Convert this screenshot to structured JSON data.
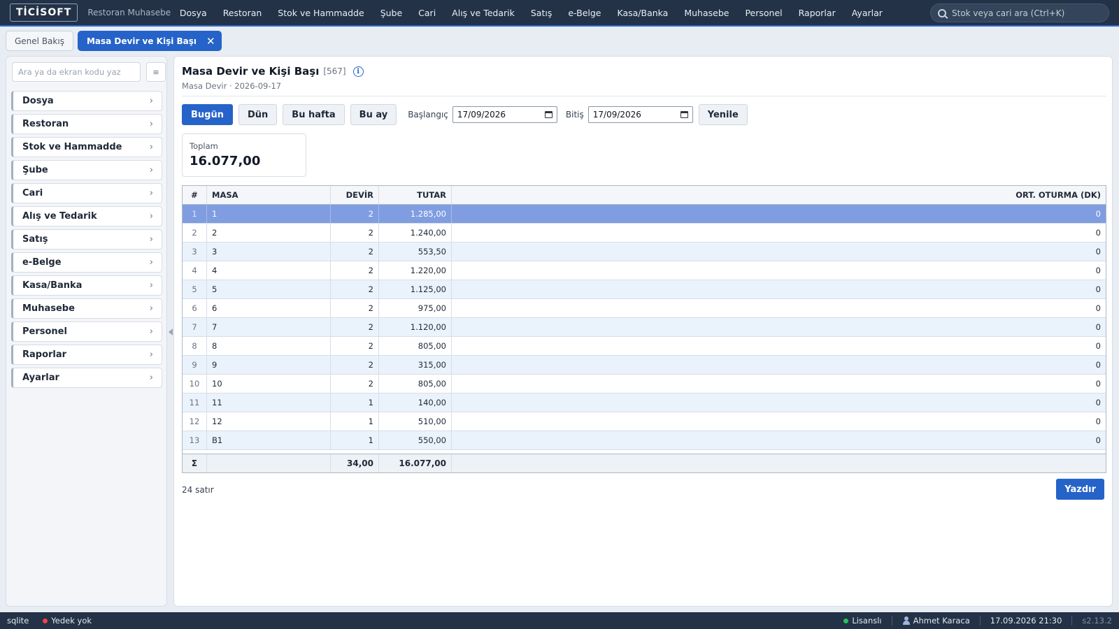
{
  "app": {
    "logo": "TİCİSOFT",
    "subtitle": "Restoran Muhasebe"
  },
  "topnav": [
    "Dosya",
    "Restoran",
    "Stok ve Hammadde",
    "Şube",
    "Cari",
    "Alış ve Tedarik",
    "Satış",
    "e-Belge",
    "Kasa/Banka",
    "Muhasebe",
    "Personel",
    "Raporlar",
    "Ayarlar"
  ],
  "search": {
    "placeholder": "Stok veya cari ara (Ctrl+K)"
  },
  "tabs": [
    {
      "label": "Genel Bakış",
      "active": false
    },
    {
      "label": "Masa Devir ve Kişi Başı",
      "active": true
    }
  ],
  "sidebar": {
    "search_placeholder": "Ara ya da ekran kodu yaz",
    "items": [
      "Dosya",
      "Restoran",
      "Stok ve Hammadde",
      "Şube",
      "Cari",
      "Alış ve Tedarik",
      "Satış",
      "e-Belge",
      "Kasa/Banka",
      "Muhasebe",
      "Personel",
      "Raporlar",
      "Ayarlar"
    ]
  },
  "page": {
    "title": "Masa Devir ve Kişi Başı",
    "code": "[567]",
    "breadcrumb": "Masa Devir · 2026-09-17"
  },
  "toolbar": {
    "today": "Bugün",
    "yesterday": "Dün",
    "this_week": "Bu hafta",
    "this_month": "Bu ay",
    "start_label": "Başlangıç",
    "start_value": "17/09/2026",
    "end_label": "Bitiş",
    "end_value": "17/09/2026",
    "refresh": "Yenile"
  },
  "summary": {
    "label": "Toplam",
    "value": "16.077,00"
  },
  "table": {
    "columns": [
      "#",
      "MASA",
      "DEVİR",
      "TUTAR",
      "ORT. OTURMA (DK)"
    ],
    "rows": [
      [
        "1",
        "1",
        "2",
        "1.285,00",
        "0"
      ],
      [
        "2",
        "2",
        "2",
        "1.240,00",
        "0"
      ],
      [
        "3",
        "3",
        "2",
        "553,50",
        "0"
      ],
      [
        "4",
        "4",
        "2",
        "1.220,00",
        "0"
      ],
      [
        "5",
        "5",
        "2",
        "1.125,00",
        "0"
      ],
      [
        "6",
        "6",
        "2",
        "975,00",
        "0"
      ],
      [
        "7",
        "7",
        "2",
        "1.120,00",
        "0"
      ],
      [
        "8",
        "8",
        "2",
        "805,00",
        "0"
      ],
      [
        "9",
        "9",
        "2",
        "315,00",
        "0"
      ],
      [
        "10",
        "10",
        "2",
        "805,00",
        "0"
      ],
      [
        "11",
        "11",
        "1",
        "140,00",
        "0"
      ],
      [
        "12",
        "12",
        "1",
        "510,00",
        "0"
      ],
      [
        "13",
        "B1",
        "1",
        "550,00",
        "0"
      ]
    ],
    "selected_row": 0,
    "footer": {
      "sigma": "Σ",
      "devir_total": "34,00",
      "tutar_total": "16.077,00"
    }
  },
  "row_count": "24 satır",
  "print_label": "Yazdır",
  "status": {
    "db": "sqlite",
    "backup": "Yedek yok",
    "license": "Lisanslı",
    "user": "Ahmet Karaca",
    "datetime": "17.09.2026 21:30",
    "version": "s2.13.2"
  },
  "colors": {
    "accent": "#2563c9",
    "topbar": "#233247",
    "selected_row": "#7f9de0",
    "alt_row": "#eaf2fb",
    "license_dot": "#22c55e",
    "backup_dot": "#ef4444"
  }
}
